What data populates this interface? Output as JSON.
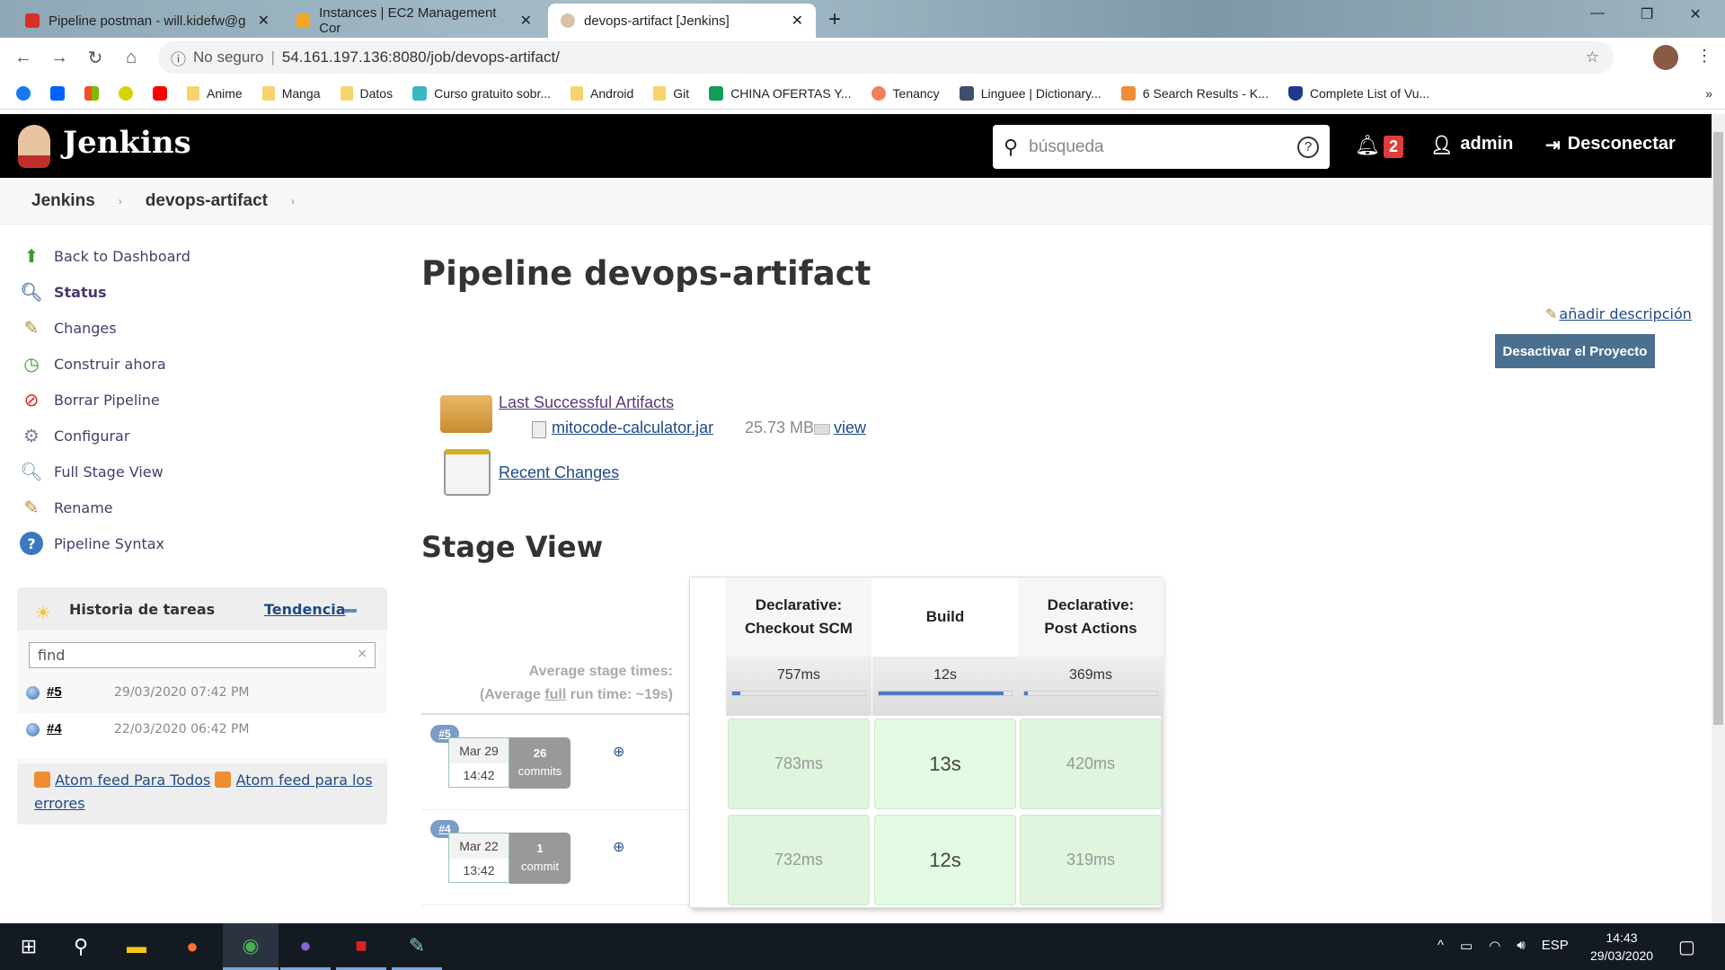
{
  "browser": {
    "tabs": [
      {
        "title": "Pipeline postman - will.kidefw@g"
      },
      {
        "title": "Instances | EC2 Management Cor"
      },
      {
        "title": "devops-artifact [Jenkins]"
      }
    ],
    "security": "No seguro",
    "url": "54.161.197.136:8080/job/devops-artifact/",
    "bookmarks": [
      "Anime",
      "Manga",
      "Datos",
      "Curso gratuito sobr...",
      "Android",
      "Git",
      "CHINA OFERTAS Y...",
      "Tenancy",
      "Linguee | Dictionary...",
      "6 Search Results - K...",
      "Complete List of Vu..."
    ]
  },
  "header": {
    "logo": "Jenkins",
    "search_placeholder": "búsqueda",
    "notifications": "2",
    "user": "admin",
    "logout": "Desconectar"
  },
  "breadcrumb": [
    "Jenkins",
    "devops-artifact"
  ],
  "sidebar": {
    "items": [
      {
        "label": "Back to Dashboard"
      },
      {
        "label": "Status"
      },
      {
        "label": "Changes"
      },
      {
        "label": "Construir ahora"
      },
      {
        "label": "Borrar Pipeline"
      },
      {
        "label": "Configurar"
      },
      {
        "label": "Full Stage View"
      },
      {
        "label": "Rename"
      },
      {
        "label": "Pipeline Syntax"
      }
    ]
  },
  "history": {
    "title": "Historia de tareas",
    "trend": "Tendencia",
    "filter_value": "find",
    "builds": [
      {
        "num": "#5",
        "date": "29/03/2020 07:42 PM"
      },
      {
        "num": "#4",
        "date": "22/03/2020 06:42 PM"
      }
    ],
    "feed_all": "Atom feed Para Todos",
    "feed_errors": "Atom feed para los errores"
  },
  "main": {
    "title": "Pipeline devops-artifact",
    "add_description": "añadir descripción",
    "disable_button": "Desactivar el Proyecto",
    "artifacts_label": "Last Successful Artifacts",
    "artifact_file": "mitocode-calculator.jar",
    "artifact_size": "25.73 MB",
    "artifact_view": "view",
    "recent_changes": "Recent Changes"
  },
  "stage_view": {
    "title": "Stage View",
    "avg_label": "Average stage times:",
    "avg_full_pre": "(Average ",
    "avg_full_link": "full",
    "avg_full_post": " run time: ~19s)",
    "stages": [
      {
        "name1": "Declarative:",
        "name2": "Checkout SCM",
        "avg": "757ms",
        "avg_fraction": 0.06
      },
      {
        "name1": "",
        "name2": "Build",
        "avg": "12s",
        "avg_fraction": 0.94
      },
      {
        "name1": "Declarative:",
        "name2": "Post Actions",
        "avg": "369ms",
        "avg_fraction": 0.03
      }
    ],
    "runs": [
      {
        "badge": "#5",
        "date": "Mar 29",
        "time": "14:42",
        "commits_n": "26",
        "commits_label": "commits",
        "durations": [
          "783ms",
          "13s",
          "420ms"
        ]
      },
      {
        "badge": "#4",
        "date": "Mar 22",
        "time": "13:42",
        "commits_n": "1",
        "commits_label": "commit",
        "durations": [
          "732ms",
          "12s",
          "319ms"
        ]
      }
    ]
  },
  "taskbar": {
    "lang": "ESP",
    "time": "14:43",
    "date": "29/03/2020"
  }
}
